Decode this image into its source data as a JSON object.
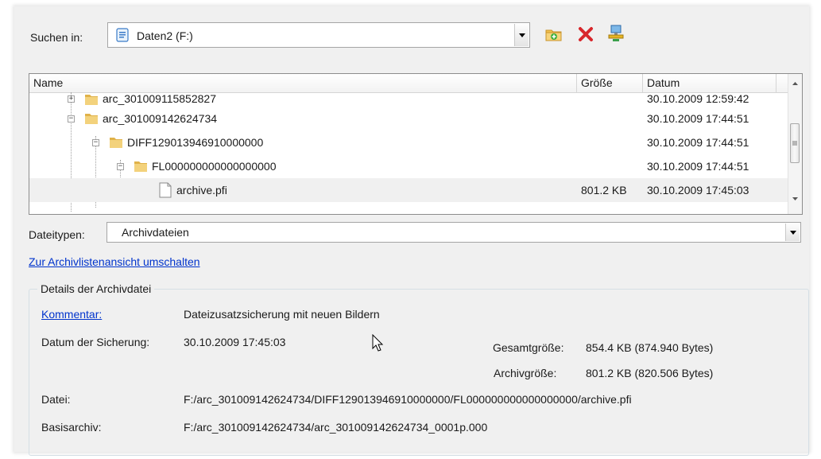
{
  "lookin": {
    "label": "Suchen in:",
    "value": "Daten2 (F:)"
  },
  "toolbar": {
    "new_folder_icon": "new-folder-icon",
    "delete_icon": "delete-icon",
    "network_icon": "network-icon"
  },
  "list": {
    "columns": [
      "Name",
      "Größe",
      "Datum"
    ],
    "rows": [
      {
        "name": "arc_301009115852827",
        "size": "",
        "date": "30.10.2009 12:59:42"
      },
      {
        "name": "arc_301009142624734",
        "size": "",
        "date": "30.10.2009 17:44:51"
      },
      {
        "name": "DIFF129013946910000000",
        "size": "",
        "date": "30.10.2009 17:44:51"
      },
      {
        "name": "FL000000000000000000",
        "size": "",
        "date": "30.10.2009 17:44:51"
      },
      {
        "name": "archive.pfi",
        "size": "801.2 KB",
        "date": "30.10.2009 17:45:03"
      }
    ]
  },
  "filetypes": {
    "label": "Dateitypen:",
    "value": "Archivdateien"
  },
  "switch_link": "Zur Archivlistenansicht umschalten",
  "details": {
    "title": "Details der Archivdatei",
    "comment_label": "Kommentar:",
    "comment_value": "Dateizusatzsicherung mit neuen Bildern",
    "date_label": "Datum der Sicherung:",
    "date_value": "30.10.2009 17:45:03",
    "total_label": "Gesamtgröße:",
    "total_value": "854.4 KB (874.940 Bytes)",
    "archive_label": "Archivgröße:",
    "archive_value": "801.2 KB (820.506 Bytes)",
    "file_label": "Datei:",
    "file_value": "F:/arc_301009142624734/DIFF129013946910000000/FL000000000000000000/archive.pfi",
    "base_label": "Basisarchiv:",
    "base_value": "F:/arc_301009142624734/arc_301009142624734_0001p.000"
  }
}
